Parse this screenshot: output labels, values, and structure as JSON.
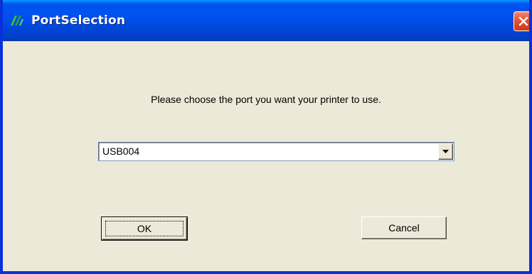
{
  "window": {
    "title": "PortSelection",
    "colors": {
      "titlebar": "#0050ee",
      "frame": "#0831d9",
      "face": "#ece9d8",
      "close": "#e2522f"
    }
  },
  "titlebar": {
    "app_icon": "app-logo-icon",
    "close_icon": "close-icon"
  },
  "dialog": {
    "prompt": "Please choose the port you want your printer to use.",
    "port_select": {
      "selected_value": "USB004",
      "arrow_icon": "dropdown-arrow-icon"
    },
    "buttons": {
      "ok_label": "OK",
      "cancel_label": "Cancel"
    }
  }
}
